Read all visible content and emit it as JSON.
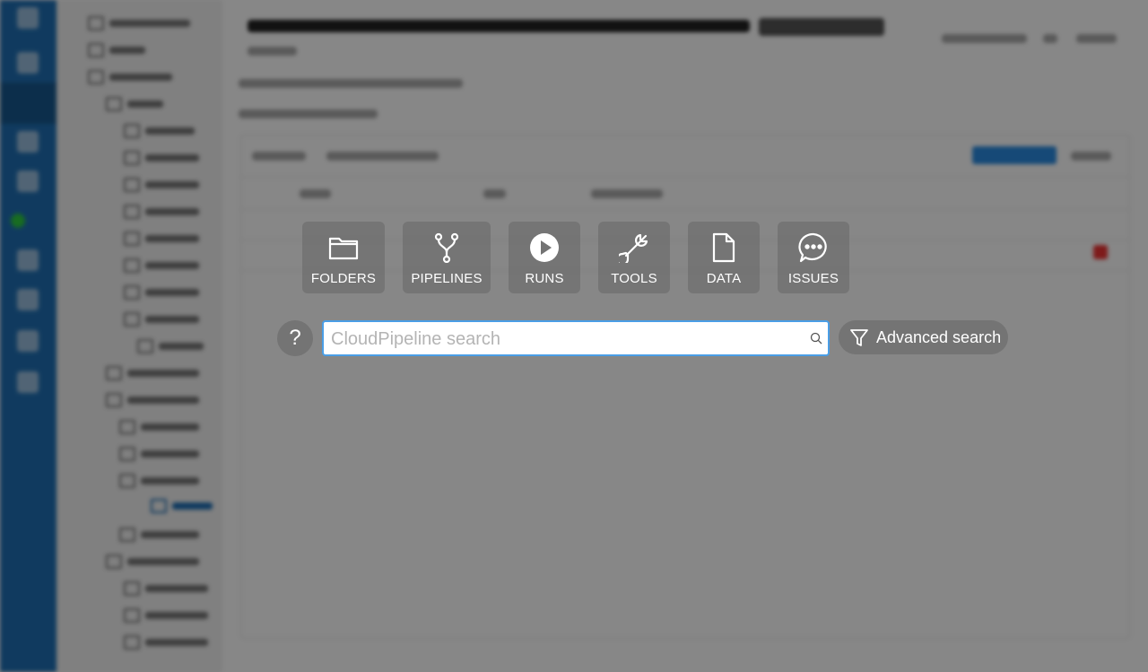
{
  "categories": [
    {
      "label": "FOLDERS",
      "icon": "folder-icon"
    },
    {
      "label": "PIPELINES",
      "icon": "pipeline-branch-icon"
    },
    {
      "label": "RUNS",
      "icon": "play-circle-icon"
    },
    {
      "label": "TOOLS",
      "icon": "wrench-tool-icon"
    },
    {
      "label": "DATA",
      "icon": "file-icon"
    },
    {
      "label": "ISSUES",
      "icon": "chat-bubble-icon"
    }
  ],
  "search": {
    "help_label": "?",
    "placeholder": "CloudPipeline search",
    "value": "",
    "advanced_label": "Advanced search"
  },
  "colors": {
    "nav_blue": "#1f6fb4",
    "overlay": "rgba(0,0,0,0.47)",
    "tile": "#737373",
    "focus_border": "#4a9ee6",
    "primary_button": "#2a8ae0"
  }
}
